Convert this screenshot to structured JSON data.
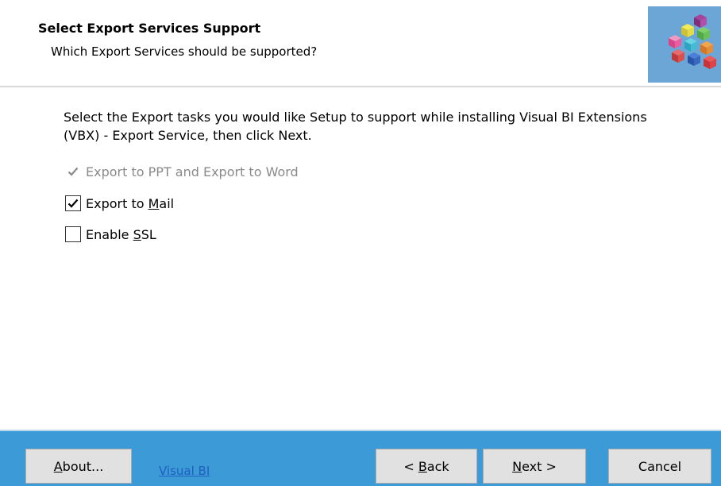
{
  "header": {
    "title": "Select Export Services Support",
    "subtitle": "Which Export Services should be supported?",
    "logo_icon": "colored-cubes-logo-icon"
  },
  "content": {
    "instructions": "Select the Export tasks you would like Setup to support while installing Visual BI Extensions (VBX) - Export Service, then click Next.",
    "options": [
      {
        "label": "Export to PPT and Export to Word",
        "checked": true,
        "enabled": false
      },
      {
        "label_before": "Export to ",
        "mnemonic": "M",
        "label_after": "ail",
        "checked": true,
        "enabled": true
      },
      {
        "label_before": "Enable ",
        "mnemonic": "S",
        "label_after": "SL",
        "checked": false,
        "enabled": true
      }
    ]
  },
  "footer": {
    "about": {
      "mnemonic": "A",
      "rest": "bout..."
    },
    "link_text": "Visual BI",
    "back": {
      "before": "< ",
      "mnemonic": "B",
      "after": "ack"
    },
    "next": {
      "mnemonic": "N",
      "after": "ext >"
    },
    "cancel": "Cancel"
  },
  "colors": {
    "footer_background": "#3c9ad7",
    "logo_background": "#6ba6d6",
    "link": "#1f5fbf",
    "disabled_text": "#8a8a8a",
    "button_face": "#e1e1e1"
  }
}
